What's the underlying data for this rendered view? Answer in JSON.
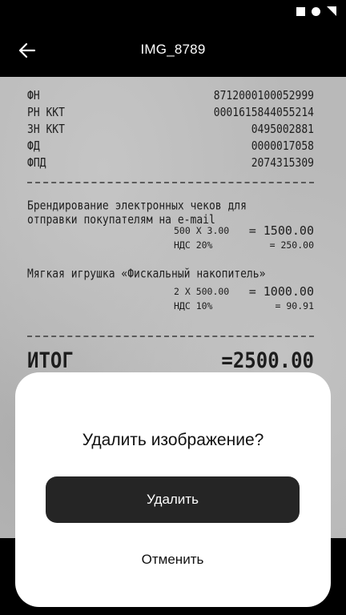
{
  "app_bar": {
    "title": "IMG_8789",
    "back_icon": "arrow-left-icon"
  },
  "status_bar": {
    "icons": [
      "square-icon",
      "circle-icon",
      "triangle-icon"
    ]
  },
  "receipt": {
    "registers": [
      {
        "label": "ФН",
        "value": "8712000100052999"
      },
      {
        "label": "РН ККТ",
        "value": "0001615844055214"
      },
      {
        "label": "ЗН ККТ",
        "value": "0495002881"
      },
      {
        "label": "ФД",
        "value": "0000017058"
      },
      {
        "label": "ФПД",
        "value": "2074315309"
      }
    ],
    "items": [
      {
        "name": "Брендирование электронных чеков для отправки покупателям на e-mail",
        "qty_price": "500 X 3.00",
        "sum": "= 1500.00",
        "vat_label": "НДС 20%",
        "vat_sum": "= 250.00"
      },
      {
        "name": "Мягкая игрушка «Фискальный накопитель»",
        "qty_price": "2 X 500.00",
        "sum": "= 1000.00",
        "vat_label": "НДС 10%",
        "vat_sum": "= 90.91"
      }
    ],
    "total_label": "ИТОГ",
    "total_value": "=2500.00"
  },
  "dialog": {
    "title": "Удалить изображение?",
    "delete_label": "Удалить",
    "cancel_label": "Отменить"
  }
}
